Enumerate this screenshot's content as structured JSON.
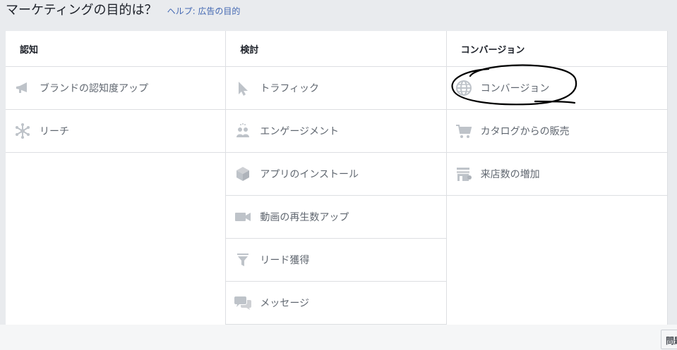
{
  "header": {
    "title": "マーケティングの目的は？",
    "help_link": "ヘルプ: 広告の目的"
  },
  "columns": [
    {
      "heading": "認知",
      "items": [
        {
          "label": "ブランドの認知度アップ",
          "icon": "megaphone-icon"
        },
        {
          "label": "リーチ",
          "icon": "reach-icon"
        }
      ]
    },
    {
      "heading": "検討",
      "items": [
        {
          "label": "トラフィック",
          "icon": "cursor-icon"
        },
        {
          "label": "エンゲージメント",
          "icon": "people-icon"
        },
        {
          "label": "アプリのインストール",
          "icon": "cube-icon"
        },
        {
          "label": "動画の再生数アップ",
          "icon": "video-camera-icon"
        },
        {
          "label": "リード獲得",
          "icon": "funnel-icon"
        },
        {
          "label": "メッセージ",
          "icon": "chat-bubbles-icon"
        }
      ]
    },
    {
      "heading": "コンバージョン",
      "items": [
        {
          "label": "コンバージョン",
          "icon": "globe-icon"
        },
        {
          "label": "カタログからの販売",
          "icon": "shopping-cart-icon"
        },
        {
          "label": "来店数の増加",
          "icon": "store-icon"
        }
      ]
    }
  ],
  "corner_button": "問題"
}
